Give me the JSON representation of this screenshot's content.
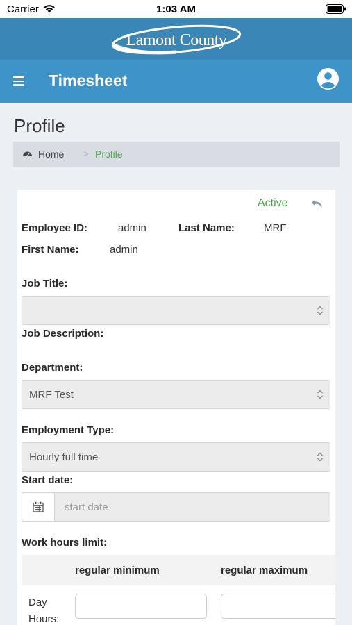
{
  "status_bar": {
    "carrier": "Carrier",
    "time": "1:03 AM"
  },
  "logo": {
    "text": "Lamont County"
  },
  "nav": {
    "title": "Timesheet"
  },
  "page": {
    "title": "Profile"
  },
  "breadcrumb": {
    "home": "Home",
    "separator": ">",
    "current": "Profile"
  },
  "profile": {
    "status": "Active",
    "employee_id_label": "Employee ID:",
    "employee_id": "admin",
    "last_name_label": "Last Name:",
    "last_name": "MRF",
    "first_name_label": "First Name:",
    "first_name": "admin",
    "job_title_label": "Job Title:",
    "job_title_value": "",
    "job_description_label": "Job Description:",
    "department_label": "Department:",
    "department_value": "MRF Test",
    "employment_type_label": "Employment Type:",
    "employment_type_value": "Hourly full time",
    "start_date_label": "Start date:",
    "start_date_placeholder": "start date",
    "work_hours_label": "Work hours limit:",
    "regular_min_label": "regular minimum",
    "regular_max_label": "regular maximum",
    "day_hours_label": "Day Hours:"
  },
  "colors": {
    "header": "#3a86b6",
    "nav": "#3e93c9",
    "active": "#4aa64a"
  }
}
